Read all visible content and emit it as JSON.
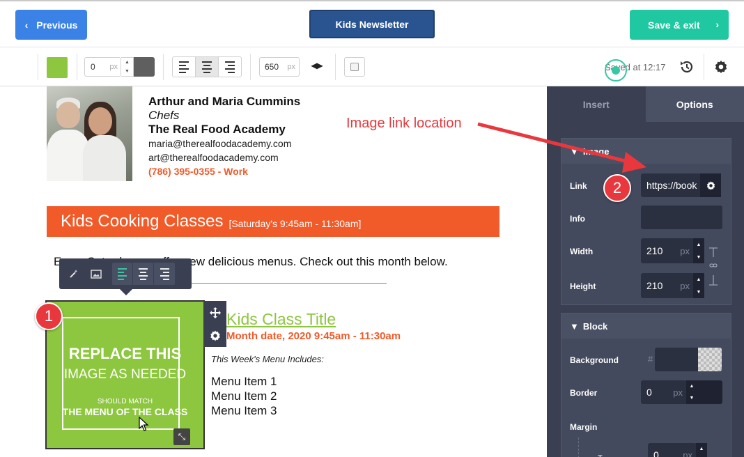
{
  "topbar": {
    "previous_label": "Previous",
    "newsletter_label": "Kids Newsletter",
    "save_label": "Save & exit"
  },
  "toolbar": {
    "border_width": "0",
    "border_unit": "px",
    "width_value": "650",
    "width_unit": "px",
    "saved_text": "Saved at 12:17",
    "colors": {
      "swatch": "#8dc63f",
      "dark": "#5f5f5f"
    }
  },
  "email": {
    "signature": {
      "name": "Arthur and Maria Cummins",
      "role": "Chefs",
      "org": "The Real Food Academy",
      "email1": "maria@therealfoodacademy.com",
      "email2": "art@therealfoodacademy.com",
      "phone": "(786) 395-0355 - Work"
    },
    "banner": {
      "title": "Kids Cooking Classes",
      "subtitle": "[Saturday's 9:45am - 11:30am]"
    },
    "intro": "Every Saturday we offer new delicious menus. Check out this month below.",
    "image": {
      "line1": "REPLACE THIS",
      "line2": "IMAGE AS NEEDED",
      "line3": "SHOULD MATCH",
      "line4": "THE MENU OF THE CLASS"
    },
    "class_title": "Kids Class Title",
    "class_date": "Month date, 2020 9:45am - 11:30am",
    "menu_label": "This Week's Menu Includes:",
    "menu_items": [
      "Menu Item 1",
      "Menu Item 2",
      "Menu Item 3"
    ]
  },
  "annotations": {
    "label": "Image link location",
    "badge1": "1",
    "badge2": "2"
  },
  "panel": {
    "tab_insert": "Insert",
    "tab_options": "Options",
    "image_section": {
      "title": "Image",
      "link_label": "Link",
      "link_value": "https://book",
      "info_label": "Info",
      "width_label": "Width",
      "width_value": "210",
      "height_label": "Height",
      "height_value": "210",
      "unit": "px"
    },
    "block_section": {
      "title": "Block",
      "background_label": "Background",
      "hash": "#",
      "border_label": "Border",
      "border_value": "0",
      "unit": "px",
      "margin_label": "Margin",
      "margin_top_label": "T",
      "margin_value": "0"
    }
  }
}
